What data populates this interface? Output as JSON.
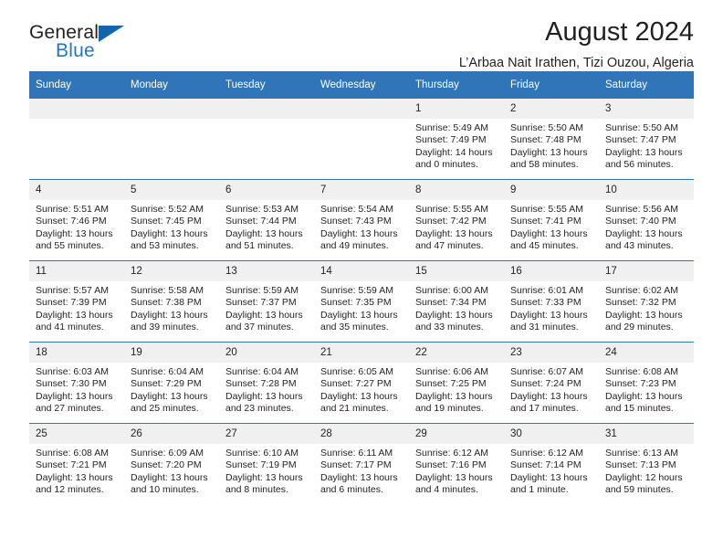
{
  "brand": {
    "word1": "General",
    "word2": "Blue",
    "triangle_color": "#1463ab",
    "blue_color": "#2276c4"
  },
  "header": {
    "title": "August 2024",
    "location": "L’Arbaa Nait Irathen, Tizi Ouzou, Algeria"
  },
  "theme": {
    "header_blue": "#3075b8",
    "daynum_bg": "#f0f0f0"
  },
  "weekdays": [
    "Sunday",
    "Monday",
    "Tuesday",
    "Wednesday",
    "Thursday",
    "Friday",
    "Saturday"
  ],
  "weeks": [
    [
      {
        "day": "",
        "lines": []
      },
      {
        "day": "",
        "lines": []
      },
      {
        "day": "",
        "lines": []
      },
      {
        "day": "",
        "lines": []
      },
      {
        "day": "1",
        "lines": [
          "Sunrise: 5:49 AM",
          "Sunset: 7:49 PM",
          "Daylight: 14 hours",
          "and 0 minutes."
        ]
      },
      {
        "day": "2",
        "lines": [
          "Sunrise: 5:50 AM",
          "Sunset: 7:48 PM",
          "Daylight: 13 hours",
          "and 58 minutes."
        ]
      },
      {
        "day": "3",
        "lines": [
          "Sunrise: 5:50 AM",
          "Sunset: 7:47 PM",
          "Daylight: 13 hours",
          "and 56 minutes."
        ]
      }
    ],
    [
      {
        "day": "4",
        "lines": [
          "Sunrise: 5:51 AM",
          "Sunset: 7:46 PM",
          "Daylight: 13 hours",
          "and 55 minutes."
        ]
      },
      {
        "day": "5",
        "lines": [
          "Sunrise: 5:52 AM",
          "Sunset: 7:45 PM",
          "Daylight: 13 hours",
          "and 53 minutes."
        ]
      },
      {
        "day": "6",
        "lines": [
          "Sunrise: 5:53 AM",
          "Sunset: 7:44 PM",
          "Daylight: 13 hours",
          "and 51 minutes."
        ]
      },
      {
        "day": "7",
        "lines": [
          "Sunrise: 5:54 AM",
          "Sunset: 7:43 PM",
          "Daylight: 13 hours",
          "and 49 minutes."
        ]
      },
      {
        "day": "8",
        "lines": [
          "Sunrise: 5:55 AM",
          "Sunset: 7:42 PM",
          "Daylight: 13 hours",
          "and 47 minutes."
        ]
      },
      {
        "day": "9",
        "lines": [
          "Sunrise: 5:55 AM",
          "Sunset: 7:41 PM",
          "Daylight: 13 hours",
          "and 45 minutes."
        ]
      },
      {
        "day": "10",
        "lines": [
          "Sunrise: 5:56 AM",
          "Sunset: 7:40 PM",
          "Daylight: 13 hours",
          "and 43 minutes."
        ]
      }
    ],
    [
      {
        "day": "11",
        "lines": [
          "Sunrise: 5:57 AM",
          "Sunset: 7:39 PM",
          "Daylight: 13 hours",
          "and 41 minutes."
        ]
      },
      {
        "day": "12",
        "lines": [
          "Sunrise: 5:58 AM",
          "Sunset: 7:38 PM",
          "Daylight: 13 hours",
          "and 39 minutes."
        ]
      },
      {
        "day": "13",
        "lines": [
          "Sunrise: 5:59 AM",
          "Sunset: 7:37 PM",
          "Daylight: 13 hours",
          "and 37 minutes."
        ]
      },
      {
        "day": "14",
        "lines": [
          "Sunrise: 5:59 AM",
          "Sunset: 7:35 PM",
          "Daylight: 13 hours",
          "and 35 minutes."
        ]
      },
      {
        "day": "15",
        "lines": [
          "Sunrise: 6:00 AM",
          "Sunset: 7:34 PM",
          "Daylight: 13 hours",
          "and 33 minutes."
        ]
      },
      {
        "day": "16",
        "lines": [
          "Sunrise: 6:01 AM",
          "Sunset: 7:33 PM",
          "Daylight: 13 hours",
          "and 31 minutes."
        ]
      },
      {
        "day": "17",
        "lines": [
          "Sunrise: 6:02 AM",
          "Sunset: 7:32 PM",
          "Daylight: 13 hours",
          "and 29 minutes."
        ]
      }
    ],
    [
      {
        "day": "18",
        "lines": [
          "Sunrise: 6:03 AM",
          "Sunset: 7:30 PM",
          "Daylight: 13 hours",
          "and 27 minutes."
        ]
      },
      {
        "day": "19",
        "lines": [
          "Sunrise: 6:04 AM",
          "Sunset: 7:29 PM",
          "Daylight: 13 hours",
          "and 25 minutes."
        ]
      },
      {
        "day": "20",
        "lines": [
          "Sunrise: 6:04 AM",
          "Sunset: 7:28 PM",
          "Daylight: 13 hours",
          "and 23 minutes."
        ]
      },
      {
        "day": "21",
        "lines": [
          "Sunrise: 6:05 AM",
          "Sunset: 7:27 PM",
          "Daylight: 13 hours",
          "and 21 minutes."
        ]
      },
      {
        "day": "22",
        "lines": [
          "Sunrise: 6:06 AM",
          "Sunset: 7:25 PM",
          "Daylight: 13 hours",
          "and 19 minutes."
        ]
      },
      {
        "day": "23",
        "lines": [
          "Sunrise: 6:07 AM",
          "Sunset: 7:24 PM",
          "Daylight: 13 hours",
          "and 17 minutes."
        ]
      },
      {
        "day": "24",
        "lines": [
          "Sunrise: 6:08 AM",
          "Sunset: 7:23 PM",
          "Daylight: 13 hours",
          "and 15 minutes."
        ]
      }
    ],
    [
      {
        "day": "25",
        "lines": [
          "Sunrise: 6:08 AM",
          "Sunset: 7:21 PM",
          "Daylight: 13 hours",
          "and 12 minutes."
        ]
      },
      {
        "day": "26",
        "lines": [
          "Sunrise: 6:09 AM",
          "Sunset: 7:20 PM",
          "Daylight: 13 hours",
          "and 10 minutes."
        ]
      },
      {
        "day": "27",
        "lines": [
          "Sunrise: 6:10 AM",
          "Sunset: 7:19 PM",
          "Daylight: 13 hours",
          "and 8 minutes."
        ]
      },
      {
        "day": "28",
        "lines": [
          "Sunrise: 6:11 AM",
          "Sunset: 7:17 PM",
          "Daylight: 13 hours",
          "and 6 minutes."
        ]
      },
      {
        "day": "29",
        "lines": [
          "Sunrise: 6:12 AM",
          "Sunset: 7:16 PM",
          "Daylight: 13 hours",
          "and 4 minutes."
        ]
      },
      {
        "day": "30",
        "lines": [
          "Sunrise: 6:12 AM",
          "Sunset: 7:14 PM",
          "Daylight: 13 hours",
          "and 1 minute."
        ]
      },
      {
        "day": "31",
        "lines": [
          "Sunrise: 6:13 AM",
          "Sunset: 7:13 PM",
          "Daylight: 12 hours",
          "and 59 minutes."
        ]
      }
    ]
  ]
}
